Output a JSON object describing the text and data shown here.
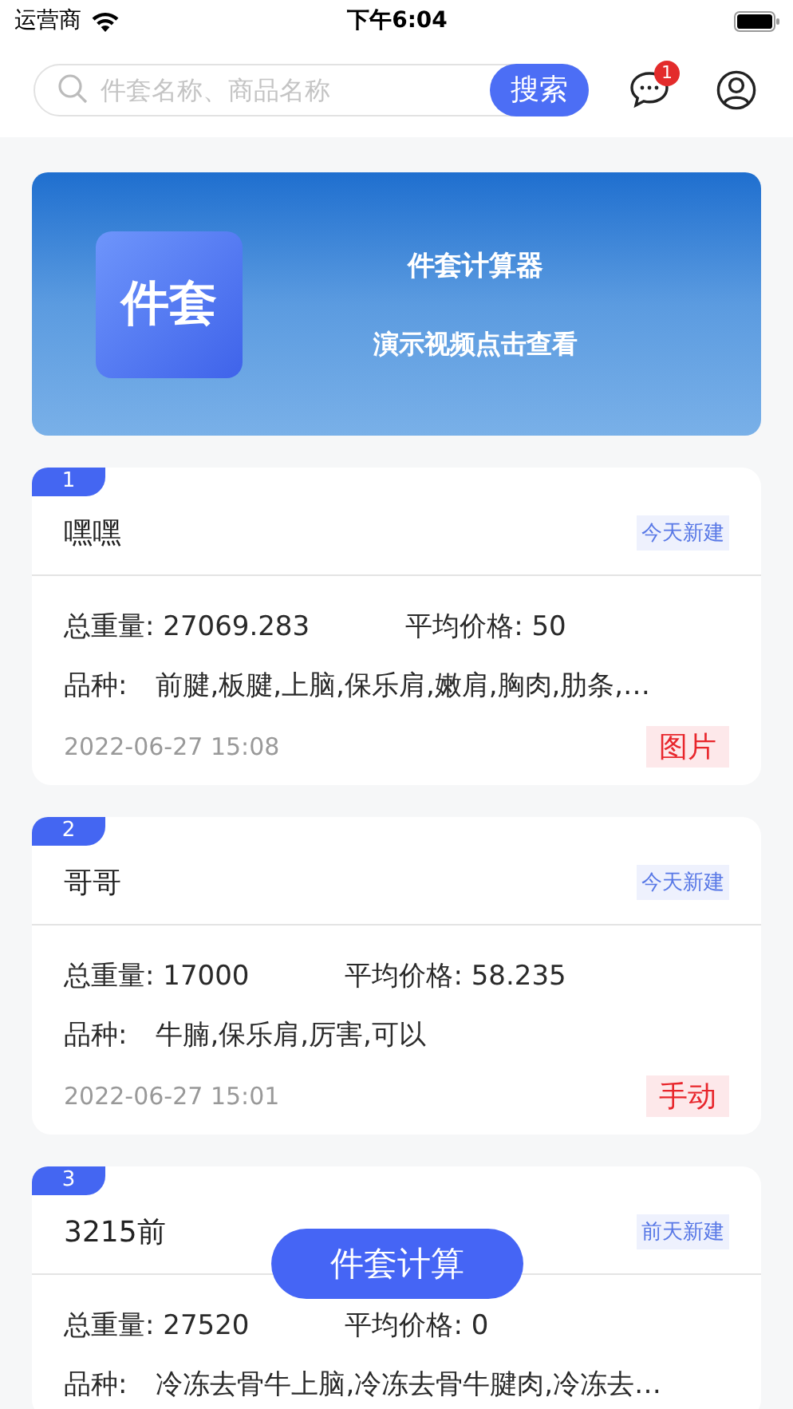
{
  "status_bar": {
    "carrier": "运营商",
    "time": "下午6:04"
  },
  "search": {
    "placeholder": "件套名称、商品名称",
    "button": "搜索"
  },
  "messages": {
    "badge": "1"
  },
  "banner": {
    "title": "件套计算器",
    "subtitle": "演示视频点击查看",
    "logo_text": "件套"
  },
  "cards": [
    {
      "number": "1",
      "title": "嘿嘿",
      "tag": "今天新建",
      "weight": "总重量: 27069.283",
      "price": "平均价格: 50",
      "variety_label": "品种:",
      "varieties": "前腱,板腱,上脑,保乐肩,嫩肩,胸肉,肋条,…",
      "time": "2022-06-27 15:08",
      "source": "图片"
    },
    {
      "number": "2",
      "title": "哥哥",
      "tag": "今天新建",
      "weight": "总重量: 17000",
      "price": "平均价格: 58.235",
      "variety_label": "品种:",
      "varieties": "牛腩,保乐肩,厉害,可以",
      "time": "2022-06-27 15:01",
      "source": "手动"
    },
    {
      "number": "3",
      "title": "3215前",
      "tag": "前天新建",
      "weight": "总重量: 27520",
      "price": "平均价格: 0",
      "variety_label": "品种:",
      "varieties": "冷冻去骨牛上脑,冷冻去骨牛腱肉,冷冻去…"
    }
  ],
  "floating_button": "件套计算"
}
